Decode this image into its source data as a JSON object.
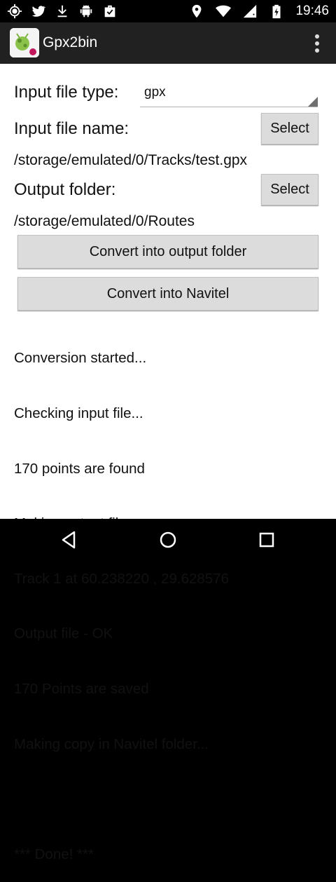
{
  "status_bar": {
    "left_icons": [
      "gps-icon",
      "twitter-icon",
      "download-icon",
      "android-icon",
      "briefcase-check-icon"
    ],
    "right_icons": [
      "location-icon",
      "wifi-icon",
      "signal-icon",
      "battery-icon"
    ],
    "time": "19:46"
  },
  "action_bar": {
    "title": "Gpx2bin",
    "overflow_icon": "overflow-menu-icon"
  },
  "form": {
    "input_type_label": "Input file type:",
    "input_type_value": "gpx",
    "input_name_label": "Input file name:",
    "select_input_label": "Select",
    "input_path": "/storage/emulated/0/Tracks/test.gpx",
    "output_folder_label": "Output folder:",
    "select_output_label": "Select",
    "output_path": "/storage/emulated/0/Routes",
    "convert_output_label": "Convert into output folder",
    "convert_navitel_label": "Convert into Navitel"
  },
  "log_lines": [
    "Conversion started...",
    "Checking input file...",
    "170 points are found",
    "Making output file...",
    "Track 1 at 60.238220 , 29.628576",
    "Output file - OK",
    "170 Points are saved",
    "Making copy in Navitel folder...",
    "",
    "*** Done! ***"
  ],
  "nav_bar": {
    "icons": [
      "back-icon",
      "home-icon",
      "recents-icon"
    ]
  },
  "colors": {
    "status_bar": "#000000",
    "action_bar": "#212121",
    "content_bg": "#ffffff",
    "button_bg": "#dcdcdc"
  }
}
